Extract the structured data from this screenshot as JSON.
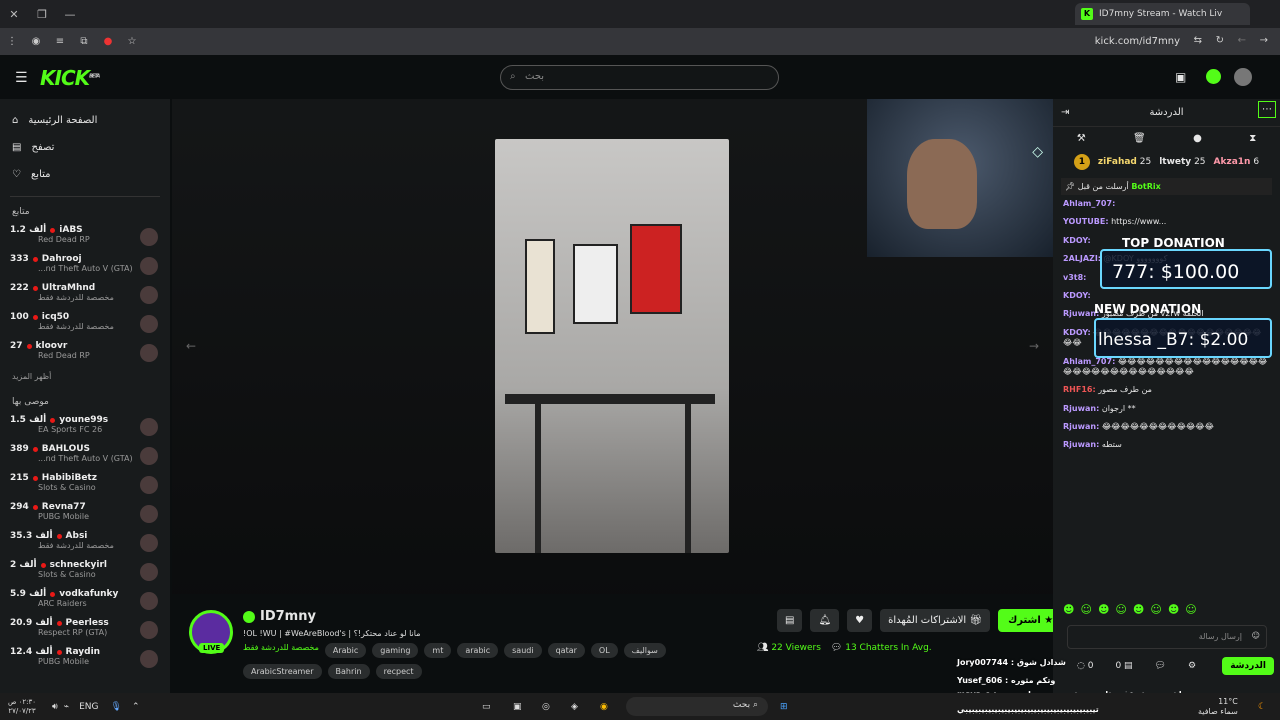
{
  "browser": {
    "tab_title": "ID7mny Stream - Watch Liv",
    "url": "kick.com/id7mny"
  },
  "header": {
    "logo": "KICK",
    "logo_badge": "BETA",
    "search_placeholder": "بحث"
  },
  "sidebar": {
    "nav": [
      {
        "label": "الصفحة الرئيسية",
        "icon": "home-icon"
      },
      {
        "label": "تصفح",
        "icon": "browse-icon"
      },
      {
        "label": "متابع",
        "icon": "heart-icon"
      }
    ],
    "following_title": "متابع",
    "following": [
      {
        "name": "iABS",
        "viewers": "1.2 ألف",
        "game": "Red Dead RP"
      },
      {
        "name": "Dahrooj",
        "viewers": "333",
        "game": "...nd Theft Auto V (GTA)"
      },
      {
        "name": "UltraMhnd",
        "viewers": "222",
        "game": "مخصصة للدردشة فقط"
      },
      {
        "name": "icq50",
        "viewers": "100",
        "game": "مخصصة للدردشة فقط"
      },
      {
        "name": "kloovr",
        "viewers": "27",
        "game": "Red Dead RP"
      }
    ],
    "show_more": "أظهر المزيد",
    "recommended_title": "موصى بها",
    "recommended": [
      {
        "name": "youne99s",
        "viewers": "1.5 ألف",
        "game": "EA Sports FC 26"
      },
      {
        "name": "BAHLOUS",
        "viewers": "389",
        "game": "...nd Theft Auto V (GTA)"
      },
      {
        "name": "HabibiBetz",
        "viewers": "215",
        "game": "Slots & Casino"
      },
      {
        "name": "Revna77",
        "viewers": "294",
        "game": "PUBG Mobile"
      },
      {
        "name": "Absi",
        "viewers": "35.3 ألف",
        "game": "مخصصة للدردشة فقط"
      },
      {
        "name": "schneckyirl",
        "viewers": "2 ألف",
        "game": "Slots & Casino"
      },
      {
        "name": "vodkafunky",
        "viewers": "5.9 ألف",
        "game": "ARC Raiders"
      },
      {
        "name": "Peerless",
        "viewers": "20.9 ألف",
        "game": "Respect RP (GTA)"
      },
      {
        "name": "Raydin",
        "viewers": "12.4 ألف",
        "game": "PUBG Mobile"
      }
    ]
  },
  "stream": {
    "channel": "ID7mny",
    "title": "!OL !WU | #WeAreBlood's | مانا لو عناد محتكر!؟",
    "category": "مخصصة للدردشة فقط",
    "tags": [
      "Arabic",
      "gaming",
      "mt",
      "arabic",
      "saudi",
      "qatar",
      "OL",
      "سواليف",
      "ArabicStreamer",
      "Bahrin",
      "recpect"
    ],
    "live_label": "LIVE",
    "viewers": "22 Viewers",
    "chatters": "13 Chatters In Avg.",
    "follow_label": "اشترك",
    "gift_label": "الاشتراكات المُهداة"
  },
  "chat": {
    "title": "الدردشة",
    "top_users": [
      {
        "rank": "1",
        "name": "ziFahad",
        "count": "25"
      },
      {
        "name": "ltwety",
        "count": "25"
      },
      {
        "name": "Akza1n",
        "count": "6"
      }
    ],
    "donation_top_title": "TOP DONATION",
    "donation_top": "777: $100.00",
    "donation_new_title": "NEW DONATION",
    "donation_new": "lhessa _B7: $2.00",
    "pinned_user": "BotRix",
    "pinned_text": "أرسلت من قبل",
    "messages": [
      {
        "user": "Ahlam_707:",
        "text": ""
      },
      {
        "user": "YOUTUBE:",
        "text": "https://www..."
      },
      {
        "user": "KDOY:",
        "text": ""
      },
      {
        "user": "2ALJAZI:",
        "text": "@KDOY كووووووو"
      },
      {
        "user": "v3t8:",
        "text": ""
      },
      {
        "user": "KDOY:",
        "text": ""
      },
      {
        "user": "Rjuwan:",
        "text": "من طرف مضبوز v2rw الحلقة"
      },
      {
        "user": "KDOY:",
        "text": "😂😂😂😂😂😂😂😂😂😂😂😂😂😂😂😂😂😂😂😂"
      },
      {
        "user": "Ahlam_707:",
        "text": "😂😂😂😂😂😂😂😂😂😂😂😂😂😂😂😂😂😂😂😂😂😂😂😂😂😂😂😂😂😂"
      },
      {
        "user": "RHF16:",
        "text": "من طرف مصور"
      },
      {
        "user": "Rjuwan:",
        "text": "ارجوان **"
      },
      {
        "user": "Rjuwan:",
        "text": "😂😂😂😂😂😂😂😂😂😂😂😂"
      },
      {
        "user": "Rjuwan:",
        "text": "ستطه"
      }
    ],
    "input_placeholder": "إرسال رسالة",
    "send_label": "الدردشة",
    "counts": [
      "0",
      "0"
    ]
  },
  "overlay": {
    "line1": "Jory007744 : شدادل شوق",
    "line2": "Yusef_606 : وتكم مثوره",
    "line3": "maya_e : باشيبيبي شوقف مثاهيتو وش سووين وانت تهم",
    "line4": "تيبيبيبيبيبيبيبيبيبيبيبيبيبيبيبيبيبيبيبيبي"
  },
  "taskbar": {
    "time": "٠٢:٣٠ ص",
    "date": "٢٧/٠٧/٢٣",
    "lang": "ENG",
    "search": "بحث",
    "weather": "11°C",
    "weather_desc": "سماء صافية"
  },
  "colors": {
    "brand": "#53fc18",
    "bg": "#0b0e0f",
    "panel": "#181b1c"
  }
}
